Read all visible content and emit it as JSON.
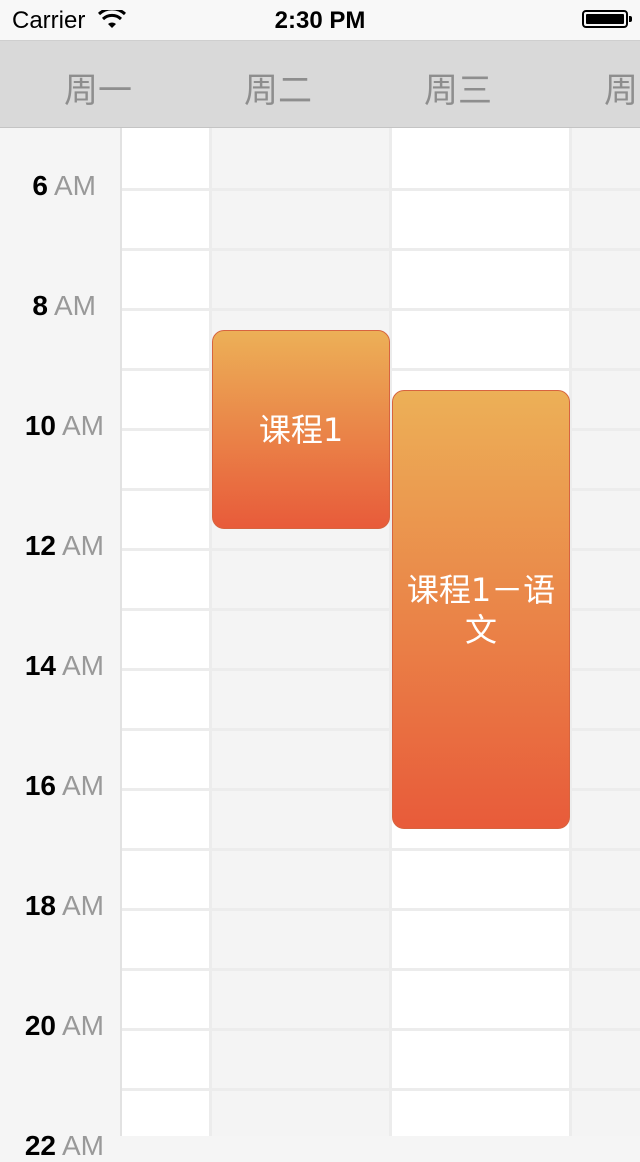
{
  "status": {
    "carrier": "Carrier",
    "time": "2:30 PM"
  },
  "days": [
    "周一",
    "周二",
    "周三",
    "周"
  ],
  "hours": [
    {
      "num": "6",
      "ampm": "AM"
    },
    {
      "num": "8",
      "ampm": "AM"
    },
    {
      "num": "10",
      "ampm": "AM"
    },
    {
      "num": "12",
      "ampm": "AM"
    },
    {
      "num": "14",
      "ampm": "AM"
    },
    {
      "num": "16",
      "ampm": "AM"
    },
    {
      "num": "18",
      "ampm": "AM"
    },
    {
      "num": "20",
      "ampm": "AM"
    },
    {
      "num": "22",
      "ampm": "AM"
    }
  ],
  "courses": [
    {
      "title": "课程1",
      "day": "周二",
      "start": "8:30",
      "end": "11:45"
    },
    {
      "title": "课程1－语文",
      "day": "周三",
      "start": "9:30",
      "end": "16:45"
    }
  ],
  "colors": {
    "course_top": "#ecb057",
    "course_bottom": "#e85b3a",
    "header_bg": "#d9d9d9"
  }
}
